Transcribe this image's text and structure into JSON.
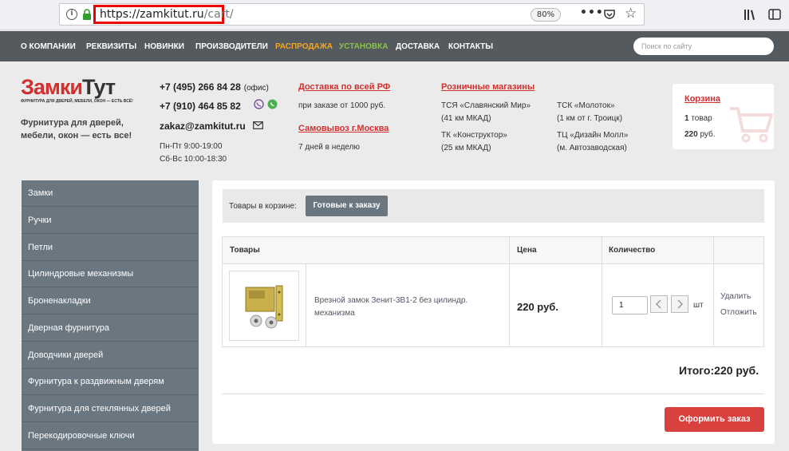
{
  "browser": {
    "url_host": "https://zamkitut.ru",
    "url_path": "/cart/",
    "zoom": "80%"
  },
  "nav": {
    "items": [
      "О КОМПАНИИ",
      "РЕКВИЗИТЫ",
      "НОВИНКИ",
      "ПРОИЗВОДИТЕЛИ",
      "РАСПРОДАЖА",
      "УСТАНОВКА",
      "ДОСТАВКА",
      "КОНТАКТЫ"
    ],
    "search_placeholder": "Поиск по сайту"
  },
  "logo": {
    "part1": "Замки",
    "part2": "Тут",
    "subtitle": "ФУРНИТУРА ДЛЯ ДВЕРЕЙ, МЕБЕЛИ, ОКОН — ЕСТЬ ВСЁ!",
    "tagline": "Фурнитура для дверей, мебели, окон — есть все!"
  },
  "contacts": {
    "phone1": "+7 (495) 266 84 28",
    "phone1_note": "(офис)",
    "phone2": "+7 (910) 464 85 82",
    "email": "zakaz@zamkitut.ru",
    "hours1": "Пн-Пт 9:00-19:00",
    "hours2": "Сб-Вс 10:00-18:30"
  },
  "delivery": {
    "link1": "Доставка по всей РФ",
    "text1": "при заказе от 1000 руб.",
    "link2": "Самовывоз г.Москва",
    "text2": "7 дней в неделю"
  },
  "stores": {
    "title": "Розничные магазины",
    "s1_name": "ТСЯ «Славянский Мир»",
    "s1_loc": "(41 км МКАД)",
    "s2_name": "ТК «Конструктор»",
    "s2_loc": "(25 км МКАД)",
    "s3_name": "ТСК «Молоток»",
    "s3_loc": "(1 км от г. Троицк)",
    "s4_name": "ТЦ «Дизайн Молл»",
    "s4_loc": "(м. Автозаводская)"
  },
  "cart": {
    "title": "Корзина",
    "count": "1",
    "count_label": "товар",
    "sum": "220",
    "sum_label": "руб."
  },
  "sidebar": {
    "items": [
      "Замки",
      "Ручки",
      "Петли",
      "Цилиндровые механизмы",
      "Броненакладки",
      "Дверная фурнитура",
      "Доводчики дверей",
      "Фурнитура к раздвижным дверям",
      "Фурнитура для стеклянных дверей",
      "Перекодировочные ключи"
    ]
  },
  "basket": {
    "filter_label": "Товары в корзине:",
    "filter_button": "Готовые к заказу",
    "headers": [
      "Товары",
      "Цена",
      "Количество"
    ],
    "product_name": "Врезной замок Зенит-3В1-2 без цилиндр. механизма",
    "price": "220 руб.",
    "quantity": "1",
    "unit": "шт",
    "delete": "Удалить",
    "postpone": "Отложить",
    "total_label": "Итого:",
    "total_value": "220 руб.",
    "order_button": "Оформить заказ"
  },
  "colors": {
    "accent_red": "#d32f2f",
    "nav_bg": "#555a5e",
    "sidebar_bg": "#6a7680",
    "sale": "#f6a623",
    "install": "#8bc34a"
  }
}
